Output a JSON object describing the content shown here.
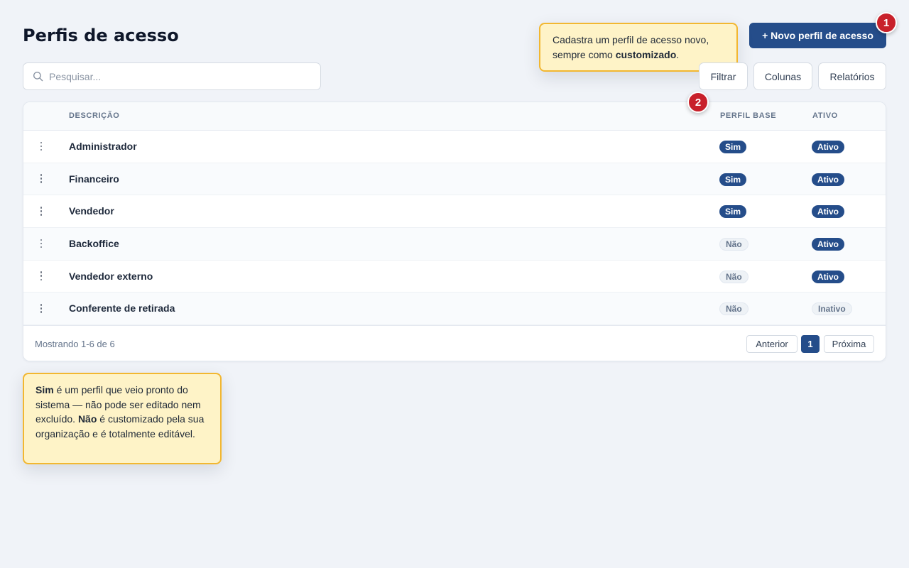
{
  "page": {
    "title": "Perfis de acesso"
  },
  "header": {
    "new_profile_button": "+ Novo perfil de acesso"
  },
  "tour": {
    "step_1": "1",
    "step_2": "2",
    "tooltip_top": {
      "text_before": "Cadastra um perfil de acesso novo, sempre como ",
      "bold": "customizado",
      "text_after": "."
    },
    "tooltip_bottom": {
      "bold_1": "Sim",
      "text_1": " é um perfil que veio pronto do sistema — não pode ser editado nem excluído. ",
      "bold_2": "Não",
      "text_2": " é customizado pela sua organização e é totalmente editável."
    }
  },
  "search": {
    "placeholder": "Pesquisar..."
  },
  "toolbar": {
    "filter_label": "Filtrar",
    "columns_label": "Colunas",
    "reports_label": "Relatórios"
  },
  "table": {
    "columns": {
      "description": "DESCRIÇÃO",
      "base_profile": "PERFIL BASE",
      "active": "ATIVO"
    },
    "rows": [
      {
        "description": "Administrador",
        "base": "Sim",
        "active": "Ativo"
      },
      {
        "description": "Financeiro",
        "base": "Sim",
        "active": "Ativo"
      },
      {
        "description": "Vendedor",
        "base": "Sim",
        "active": "Ativo"
      },
      {
        "description": "Backoffice",
        "base": "Não",
        "active": "Ativo"
      },
      {
        "description": "Vendedor externo",
        "base": "Não",
        "active": "Ativo"
      },
      {
        "description": "Conferente de retirada",
        "base": "Não",
        "active": "Inativo"
      }
    ]
  },
  "footer": {
    "showing_text": "Mostrando 1-6 de 6",
    "prev_label": "Anterior",
    "current_page": "1",
    "next_label": "Próxima"
  },
  "colors": {
    "primary": "#254d8a",
    "step_badge": "#c8202a",
    "tooltip_bg": "#fef3c7",
    "tooltip_border": "#f2b731",
    "page_bg": "#f0f3f8"
  },
  "icons": {
    "search": "search-icon",
    "row_menu": "kebab-menu-icon"
  }
}
